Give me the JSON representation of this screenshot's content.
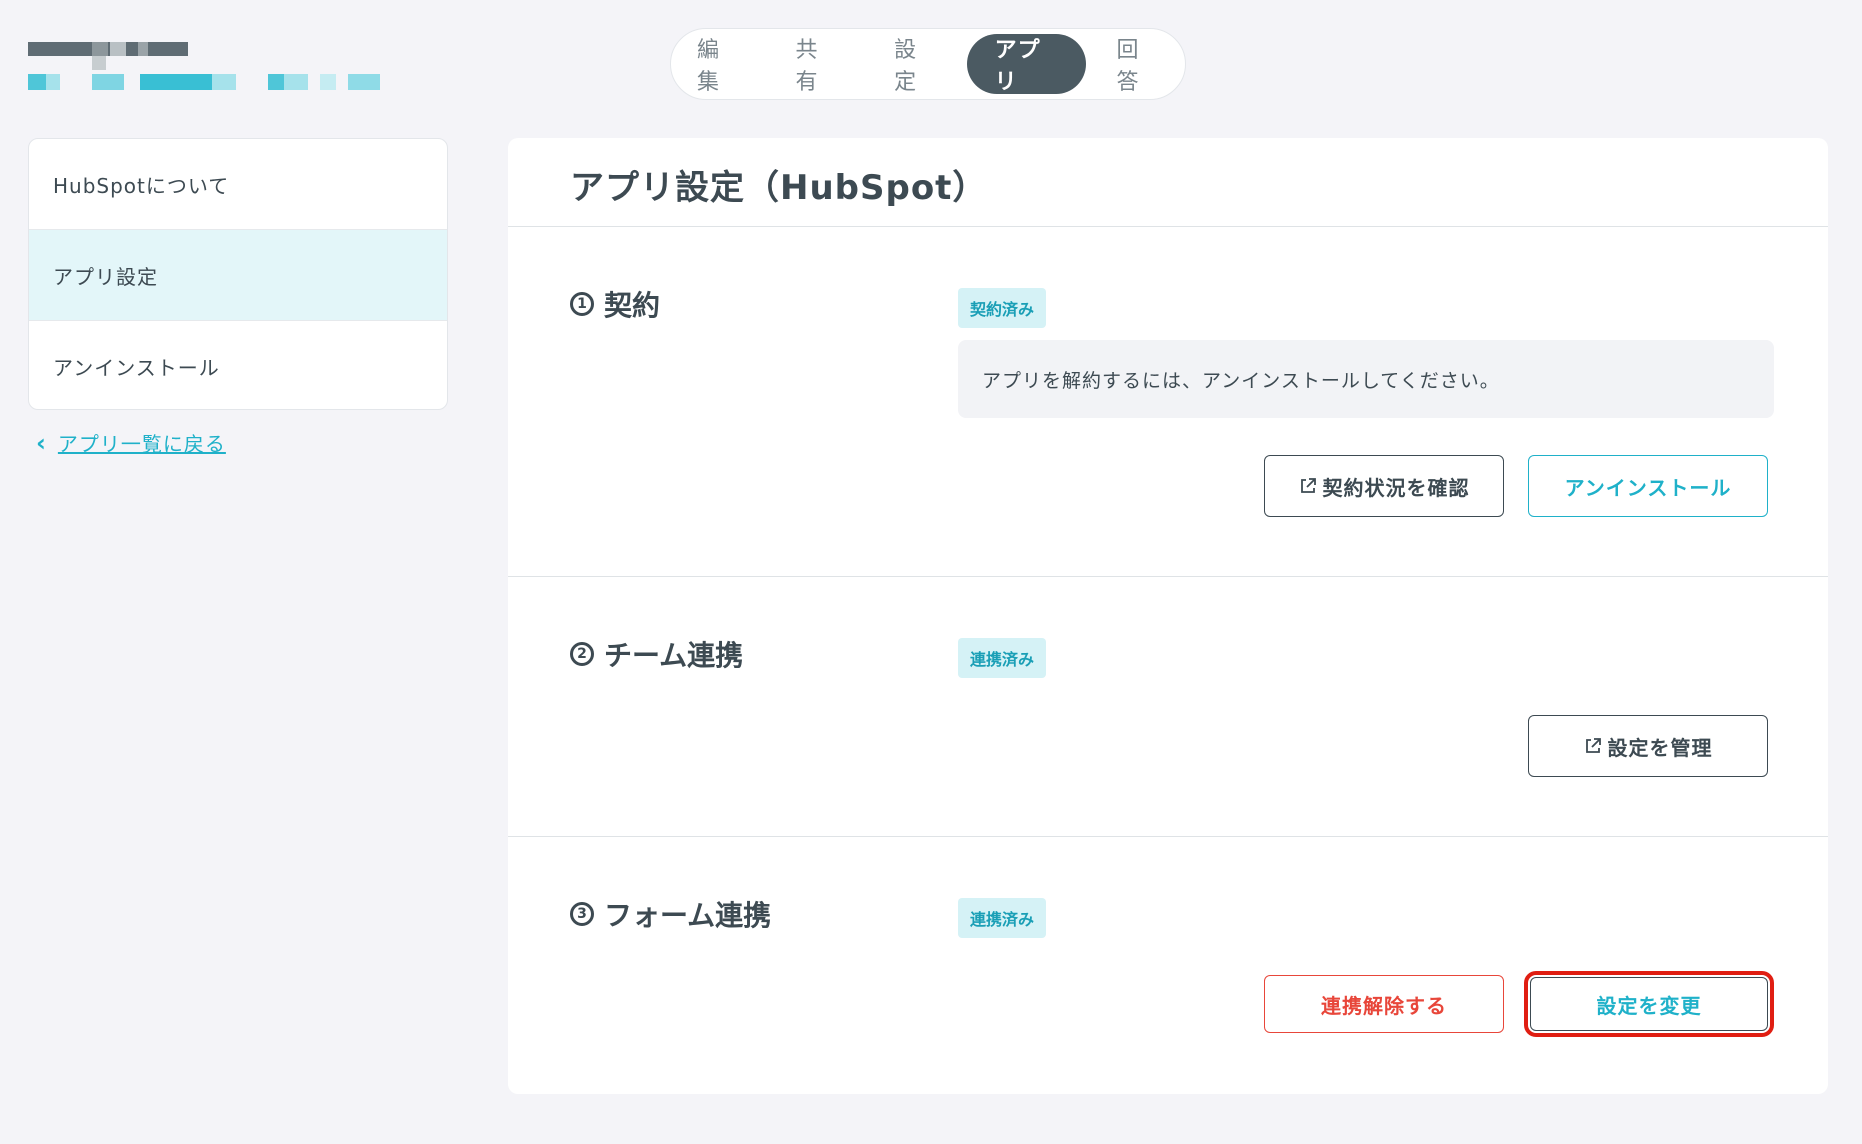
{
  "tabs": [
    {
      "label": "編集",
      "active": false
    },
    {
      "label": "共有",
      "active": false
    },
    {
      "label": "設定",
      "active": false
    },
    {
      "label": "アプリ",
      "active": true
    },
    {
      "label": "回答",
      "active": false
    }
  ],
  "sidebar": {
    "items": [
      {
        "label": "HubSpotについて",
        "active": false
      },
      {
        "label": "アプリ設定",
        "active": true
      },
      {
        "label": "アンインストール",
        "active": false
      }
    ],
    "back_link": "アプリ一覧に戻る"
  },
  "main": {
    "title": "アプリ設定（HubSpot）",
    "sections": [
      {
        "number": "1",
        "title": "契約",
        "badge": "契約済み",
        "info": "アプリを解約するには、アンインストールしてください。",
        "buttons": [
          "契約状況を確認",
          "アンインストール"
        ]
      },
      {
        "number": "2",
        "title": "チーム連携",
        "badge": "連携済み",
        "buttons": [
          "設定を管理"
        ]
      },
      {
        "number": "3",
        "title": "フォーム連携",
        "badge": "連携済み",
        "buttons": [
          "連携解除する",
          "設定を変更"
        ]
      }
    ]
  },
  "colors": {
    "accent": "#1fb1c9",
    "dark": "#4b5a62",
    "danger": "#e8463a",
    "highlight": "#e01e12",
    "background": "#f4f4f8"
  }
}
